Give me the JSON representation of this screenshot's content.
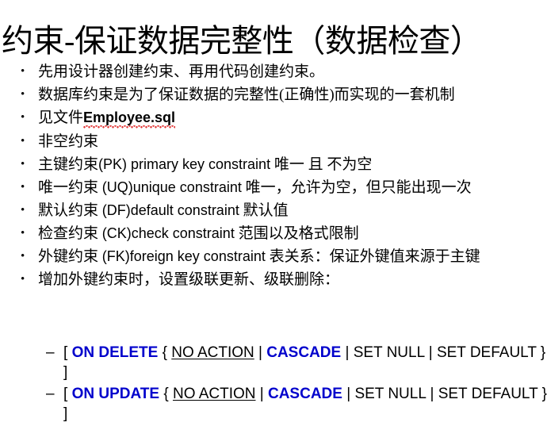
{
  "slide": {
    "title": "约束-保证数据完整性（数据检查）",
    "bullet_marker": "•",
    "sub_marker": "–",
    "accent_color": "#0000cc",
    "spellcheck_underline_color": "#e03030",
    "background_color": "#ffffff",
    "text_color": "#000000"
  },
  "bullets": [
    {
      "id": "designer-then-code",
      "text": "先用设计器创建约束、再用代码创建约束。"
    },
    {
      "id": "constraint-definition",
      "text": "数据库约束是为了保证数据的完整性(正确性)而实现的一套机制"
    },
    {
      "id": "see-file",
      "prefix": "见文件",
      "file": "Employee.sql"
    },
    {
      "id": "not-null",
      "text": "非空约束"
    },
    {
      "id": "primary-key",
      "lead": "主键约束",
      "latin": "(PK) primary key constraint",
      "tail": "唯一 且 不为空"
    },
    {
      "id": "unique",
      "lead": "唯一约束",
      "latin": "(UQ)unique constraint",
      "tail": "唯一，允许为空，但只能出现一次"
    },
    {
      "id": "default",
      "lead": "默认约束",
      "latin": "(DF)default constraint",
      "tail": "默认值"
    },
    {
      "id": "check",
      "lead": "检查约束",
      "latin": "(CK)check constraint",
      "tail": "范围以及格式限制"
    },
    {
      "id": "foreign-key",
      "lead": "外键约束",
      "latin": "(FK)foreign key constraint",
      "tail": "表关系：保证外键值来源于主键"
    },
    {
      "id": "cascade-intro",
      "text": "增加外键约束时，设置级联更新、级联删除："
    }
  ],
  "sub_items": [
    {
      "id": "on-delete",
      "open_bracket": "[",
      "keyword": "ON DELETE",
      "open_brace": "{",
      "option_underlined": "NO ACTION",
      "sep1": "|",
      "option_highlight": "CASCADE",
      "sep2": "|",
      "option_plain_1": "SET NULL",
      "sep3": "|",
      "option_plain_2": "SET DEFAULT",
      "close_brace": "}",
      "close_bracket": "]"
    },
    {
      "id": "on-update",
      "open_bracket": "[",
      "keyword": "ON UPDATE",
      "open_brace": "{",
      "option_underlined": "NO ACTION",
      "sep1": "|",
      "option_highlight": "CASCADE",
      "sep2": "|",
      "option_plain_1": "SET NULL",
      "sep3": "|",
      "option_plain_2": "SET DEFAULT",
      "close_brace": "}",
      "close_bracket": "]"
    }
  ]
}
